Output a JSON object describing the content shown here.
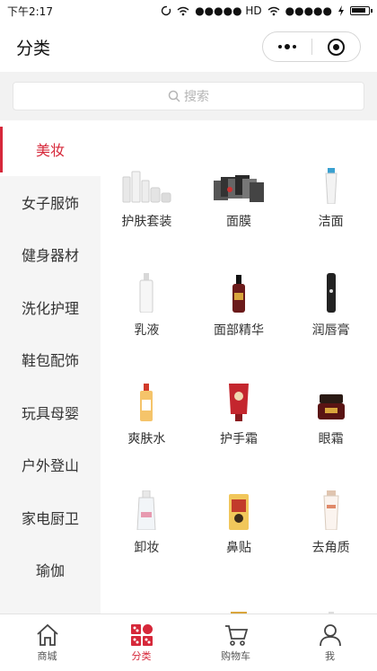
{
  "status_bar": {
    "time": "下午2:17",
    "carrier": "●●●●● HD",
    "carrier2": "●●●●●"
  },
  "nav": {
    "title": "分类"
  },
  "search": {
    "placeholder": "搜索"
  },
  "sidebar": {
    "items": [
      {
        "label": "美妆",
        "active": true
      },
      {
        "label": "女子服饰"
      },
      {
        "label": "健身器材"
      },
      {
        "label": "洗化护理"
      },
      {
        "label": "鞋包配饰"
      },
      {
        "label": "玩具母婴"
      },
      {
        "label": "户外登山"
      },
      {
        "label": "家电厨卫"
      },
      {
        "label": "瑜伽"
      }
    ]
  },
  "products": [
    {
      "label": "护肤套装",
      "icon": "skincare-set-icon"
    },
    {
      "label": "面膜",
      "icon": "face-mask-icon"
    },
    {
      "label": "洁面",
      "icon": "cleanser-icon"
    },
    {
      "label": "乳液",
      "icon": "lotion-icon"
    },
    {
      "label": "面部精华",
      "icon": "serum-icon"
    },
    {
      "label": "润唇膏",
      "icon": "lip-balm-icon"
    },
    {
      "label": "爽肤水",
      "icon": "toner-icon"
    },
    {
      "label": "护手霜",
      "icon": "hand-cream-icon"
    },
    {
      "label": "眼霜",
      "icon": "eye-cream-icon"
    },
    {
      "label": "卸妆",
      "icon": "makeup-remover-icon"
    },
    {
      "label": "鼻贴",
      "icon": "nose-strip-icon"
    },
    {
      "label": "去角质",
      "icon": "exfoliator-icon"
    }
  ],
  "tabs": [
    {
      "label": "商城",
      "icon": "home-icon"
    },
    {
      "label": "分类",
      "icon": "category-icon",
      "active": true
    },
    {
      "label": "购物车",
      "icon": "cart-icon"
    },
    {
      "label": "我",
      "icon": "user-icon"
    }
  ],
  "colors": {
    "accent": "#d6283a",
    "sidebar_bg": "#f5f5f5",
    "search_bg": "#f2f2f2"
  }
}
